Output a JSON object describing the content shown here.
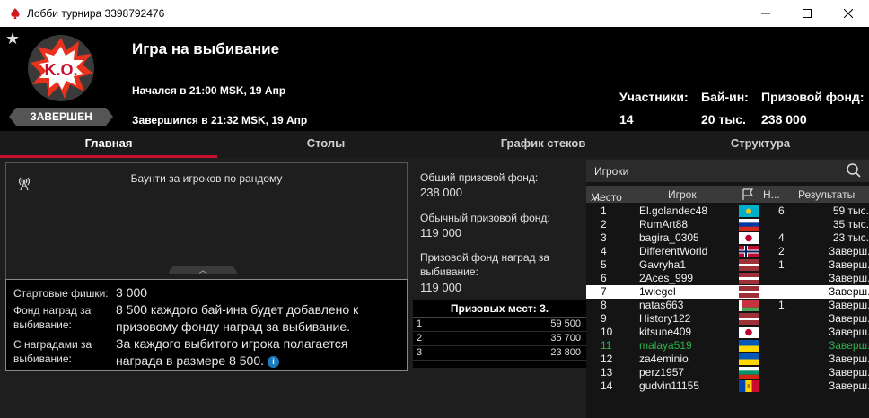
{
  "window": {
    "title": "Лобби турнира 3398792476",
    "app_icon": "pokerstars-spade-icon",
    "controls": [
      "minimize-icon",
      "maximize-icon",
      "close-icon"
    ]
  },
  "header": {
    "logo_text": "K.O.",
    "status": "ЗАВЕРШЕН",
    "name": "Игра на выбивание",
    "started": "Начался в 21:00 MSK, 19 Апр",
    "ended": "Завершился в 21:32 MSK, 19 Апр",
    "stats": {
      "participants_label": "Участники:",
      "participants_value": "14",
      "buyin_label": "Бай-ин:",
      "buyin_value": "20 тыс.",
      "prize_label": "Призовой фонд:",
      "prize_value": "238 000"
    }
  },
  "tabs": [
    {
      "label": "Главная",
      "active": true
    },
    {
      "label": "Столы",
      "active": false
    },
    {
      "label": "График стеков",
      "active": false
    },
    {
      "label": "Структура",
      "active": false
    }
  ],
  "info_panel": {
    "text": "Баунти за игроков по рандому"
  },
  "details": {
    "starting_chips_label": "Стартовые фишки:",
    "starting_chips_value": "3 000",
    "bounty_fund_label_1": "Фонд наград за",
    "bounty_fund_label_2": "выбивание:",
    "bounty_fund_value_1": "8 500 каждого бай-ина будет добавлено к",
    "bounty_fund_value_2": "призовому фонду наград за выбивание.",
    "with_bounty_label_1": "С наградами за",
    "with_bounty_label_2": "выбивание:",
    "with_bounty_value_1": "За каждого выбитого игрока полагается",
    "with_bounty_value_2": "награда в размере 8 500.",
    "info_icon": "i"
  },
  "prize": {
    "total_label": "Общий призовой фонд:",
    "total_value": "238 000",
    "regular_label": "Обычный призовой фонд:",
    "regular_value": "119 000",
    "bounty_label_1": "Призовой фонд наград за",
    "bounty_label_2": "выбивание:",
    "bounty_value": "119 000",
    "places_title": "Призовых мест: 3.",
    "places": [
      {
        "place": "1",
        "amount": "59 500"
      },
      {
        "place": "2",
        "amount": "35 700"
      },
      {
        "place": "3",
        "amount": "23 800"
      }
    ]
  },
  "players": {
    "title": "Игроки",
    "columns": {
      "place": "Место",
      "player": "Игрок",
      "ko": "Н...",
      "results": "Результаты"
    },
    "rows": [
      {
        "place": "1",
        "name": "El.golandec48",
        "ko": "6",
        "result": "59 тыс.",
        "flag": "kazakhstan",
        "state": ""
      },
      {
        "place": "2",
        "name": "RumArt88",
        "ko": "",
        "result": "35 тыс.",
        "flag": "russia",
        "state": ""
      },
      {
        "place": "3",
        "name": "bagira_0305",
        "ko": "4",
        "result": "23 тыс.",
        "flag": "japan",
        "state": ""
      },
      {
        "place": "4",
        "name": "DifferentWorld",
        "ko": "2",
        "result": "Заверш.",
        "flag": "norway",
        "state": ""
      },
      {
        "place": "5",
        "name": "Gavryha1",
        "ko": "1",
        "result": "Заверш.",
        "flag": "latvia",
        "state": ""
      },
      {
        "place": "6",
        "name": "2Aces_999",
        "ko": "",
        "result": "Заверш.",
        "flag": "latvia",
        "state": ""
      },
      {
        "place": "7",
        "name": "1wiegel",
        "ko": "",
        "result": "Заверш.",
        "flag": "latvia",
        "state": "selected"
      },
      {
        "place": "8",
        "name": "natas663",
        "ko": "1",
        "result": "Заверш.",
        "flag": "belarus",
        "state": ""
      },
      {
        "place": "9",
        "name": "History122",
        "ko": "",
        "result": "Заверш.",
        "flag": "latvia",
        "state": ""
      },
      {
        "place": "10",
        "name": "kitsune409",
        "ko": "",
        "result": "Заверш.",
        "flag": "japan",
        "state": ""
      },
      {
        "place": "11",
        "name": "malaya519",
        "ko": "",
        "result": "Заверш.",
        "flag": "ukraine",
        "state": "elim"
      },
      {
        "place": "12",
        "name": "za4eminio",
        "ko": "",
        "result": "Заверш.",
        "flag": "ukraine",
        "state": ""
      },
      {
        "place": "13",
        "name": "perz1957",
        "ko": "",
        "result": "Заверш.",
        "flag": "bulgaria",
        "state": ""
      },
      {
        "place": "14",
        "name": "gudvin11155",
        "ko": "",
        "result": "Заверш.",
        "flag": "moldova",
        "state": ""
      }
    ]
  }
}
